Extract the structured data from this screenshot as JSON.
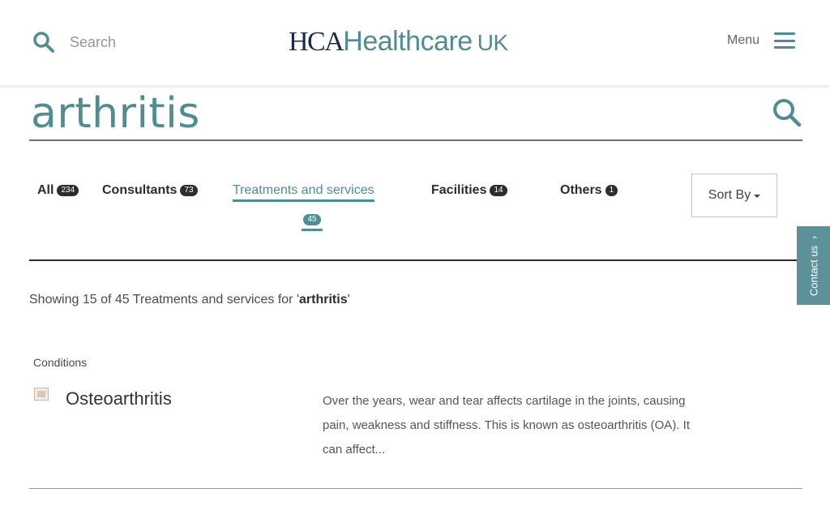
{
  "header": {
    "search_label": "Search",
    "logo": {
      "part1": "HCA",
      "part2": "Healthcare",
      "part3": "UK"
    },
    "menu_label": "Menu"
  },
  "query": {
    "text": "arthritis"
  },
  "tabs": [
    {
      "label": "All",
      "count": "234",
      "active": false
    },
    {
      "label": "Consultants",
      "count": "73",
      "active": false
    },
    {
      "label": "Treatments and services",
      "count": "45",
      "active": true
    },
    {
      "label": "Facilities",
      "count": "14",
      "active": false
    },
    {
      "label": "Others",
      "count": "1",
      "active": false
    }
  ],
  "sort": {
    "label": "Sort By"
  },
  "contact": {
    "label": "Contact us"
  },
  "results": {
    "summary_prefix": "Showing 15 of 45 Treatments and services for '",
    "summary_term": "arthritis",
    "summary_suffix": "'",
    "category": "Conditions",
    "items": [
      {
        "title": "Osteoarthritis",
        "description": "Over the years, wear and tear affects cartilage in the joints, causing pain, weakness and stiffness. This is known as osteoarthritis (OA). It can affect..."
      }
    ]
  },
  "colors": {
    "brand_teal": "#4f8d95",
    "brand_navy": "#1c2b4b",
    "contact_bg": "#5c9199"
  }
}
